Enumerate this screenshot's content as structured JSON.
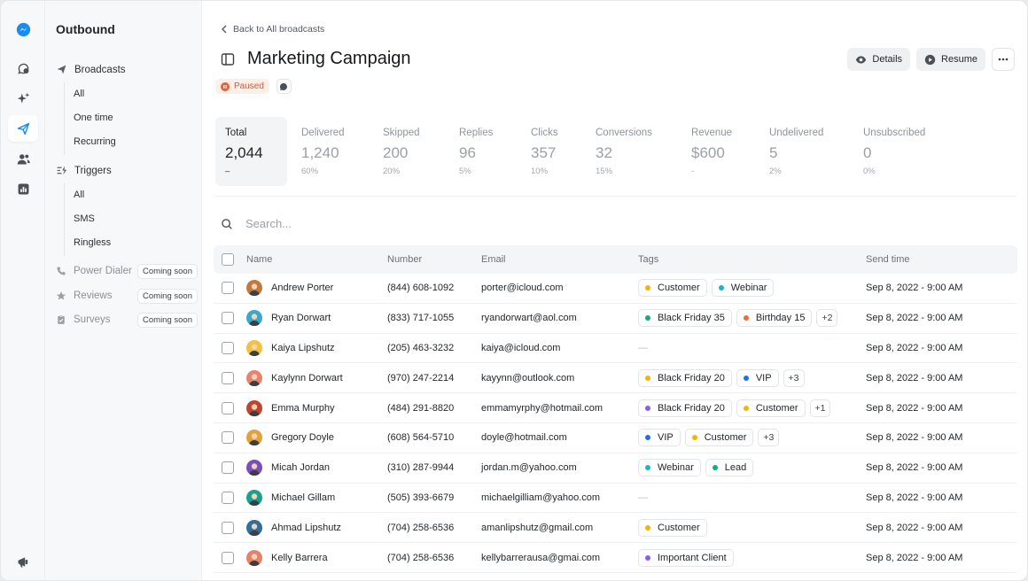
{
  "sidebar": {
    "title": "Outbound",
    "broadcasts": {
      "label": "Broadcasts",
      "items": [
        "All",
        "One time",
        "Recurring"
      ]
    },
    "triggers": {
      "label": "Triggers",
      "items": [
        "All",
        "SMS",
        "Ringless"
      ]
    },
    "upcoming": [
      {
        "label": "Power Dialer",
        "badge": "Coming soon"
      },
      {
        "label": "Reviews",
        "badge": "Coming soon"
      },
      {
        "label": "Surveys",
        "badge": "Coming soon"
      }
    ]
  },
  "header": {
    "back_label": "Back to All broadcasts",
    "title": "Marketing Campaign",
    "status": "Paused",
    "details_label": "Details",
    "resume_label": "Resume"
  },
  "stats": [
    {
      "label": "Total",
      "value": "2,044",
      "pct": "–"
    },
    {
      "label": "Delivered",
      "value": "1,240",
      "pct": "60%"
    },
    {
      "label": "Skipped",
      "value": "200",
      "pct": "20%"
    },
    {
      "label": "Replies",
      "value": "96",
      "pct": "5%"
    },
    {
      "label": "Clicks",
      "value": "357",
      "pct": "10%"
    },
    {
      "label": "Conversions",
      "value": "32",
      "pct": "15%"
    },
    {
      "label": "Revenue",
      "value": "$600",
      "pct": "-"
    },
    {
      "label": "Undelivered",
      "value": "5",
      "pct": "2%"
    },
    {
      "label": "Unsubscribed",
      "value": "0",
      "pct": "0%"
    }
  ],
  "search": {
    "placeholder": "Search..."
  },
  "table": {
    "columns": [
      "Name",
      "Number",
      "Email",
      "Tags",
      "Send time"
    ],
    "rows": [
      {
        "name": "Andrew Porter",
        "number": "(844) 608-1092",
        "email": "porter@icloud.com",
        "tags": [
          {
            "label": "Customer",
            "color": "#f5b400"
          },
          {
            "label": "Webinar",
            "color": "#19b5c9"
          }
        ],
        "more": "",
        "send_time": "Sep 8, 2022 - 9:00 AM",
        "avatar_color": "#c07a3c"
      },
      {
        "name": "Ryan Dorwart",
        "number": "(833) 717-1055",
        "email": "ryandorwart@aol.com",
        "tags": [
          {
            "label": "Black Friday 35",
            "color": "#14a884"
          },
          {
            "label": "Birthday 15",
            "color": "#f06a3a"
          }
        ],
        "more": "+2",
        "send_time": "Sep 8, 2022 - 9:00 AM",
        "avatar_color": "#3aa8c9"
      },
      {
        "name": "Kaiya Lipshutz",
        "number": "(205) 463-3232",
        "email": "kaiya@icloud.com",
        "tags": [],
        "more": "",
        "empty": "—",
        "send_time": "Sep 8, 2022 - 9:00 AM",
        "avatar_color": "#f2c13d"
      },
      {
        "name": "Kaylynn Dorwart",
        "number": "(970) 247-2214",
        "email": "kayynn@outlook.com",
        "tags": [
          {
            "label": "Black Friday 20",
            "color": "#f5b400"
          },
          {
            "label": "VIP",
            "color": "#1f6ff2"
          }
        ],
        "more": "+3",
        "send_time": "Sep 8, 2022 - 9:00 AM",
        "avatar_color": "#e9836f"
      },
      {
        "name": "Emma Murphy",
        "number": "(484) 291-8820",
        "email": "emmamyrphy@hotmail.com",
        "tags": [
          {
            "label": "Black Friday 20",
            "color": "#8a5cf0"
          },
          {
            "label": "Customer",
            "color": "#f5b400"
          }
        ],
        "more": "+1",
        "send_time": "Sep 8, 2022 - 9:00 AM",
        "avatar_color": "#c0442f"
      },
      {
        "name": "Gregory Doyle",
        "number": "(608) 564-5710",
        "email": "doyle@hotmail.com",
        "tags": [
          {
            "label": "VIP",
            "color": "#1f6ff2"
          },
          {
            "label": "Customer",
            "color": "#f5b400"
          }
        ],
        "more": "+3",
        "send_time": "Sep 8, 2022 - 9:00 AM",
        "avatar_color": "#e2a23a"
      },
      {
        "name": "Micah Jordan",
        "number": "(310) 287-9944",
        "email": "jordan.m@yahoo.com",
        "tags": [
          {
            "label": "Webinar",
            "color": "#19b5c9"
          },
          {
            "label": "Lead",
            "color": "#14a884"
          }
        ],
        "more": "",
        "send_time": "Sep 8, 2022 - 9:00 AM",
        "avatar_color": "#7a4fb8"
      },
      {
        "name": "Michael Gillam",
        "number": "(505) 393-6679",
        "email": "michaelgilliam@yahoo.com",
        "tags": [],
        "more": "",
        "empty": "—",
        "send_time": "Sep 8, 2022 - 9:00 AM",
        "avatar_color": "#1aa18e"
      },
      {
        "name": "Ahmad Lipshutz",
        "number": "(704) 258-6536",
        "email": "amanlipshutz@gmail.com",
        "tags": [
          {
            "label": "Customer",
            "color": "#f5b400"
          }
        ],
        "more": "",
        "send_time": "Sep 8, 2022 - 9:00 AM",
        "avatar_color": "#2f6f9a"
      },
      {
        "name": "Kelly Barrera",
        "number": "(704) 258-6536",
        "email": "kellybarrerausa@gmai.com",
        "tags": [
          {
            "label": "Important Client",
            "color": "#8a5cf0"
          }
        ],
        "more": "",
        "send_time": "Sep 8, 2022 - 9:00 AM",
        "avatar_color": "#e7826a"
      }
    ]
  }
}
